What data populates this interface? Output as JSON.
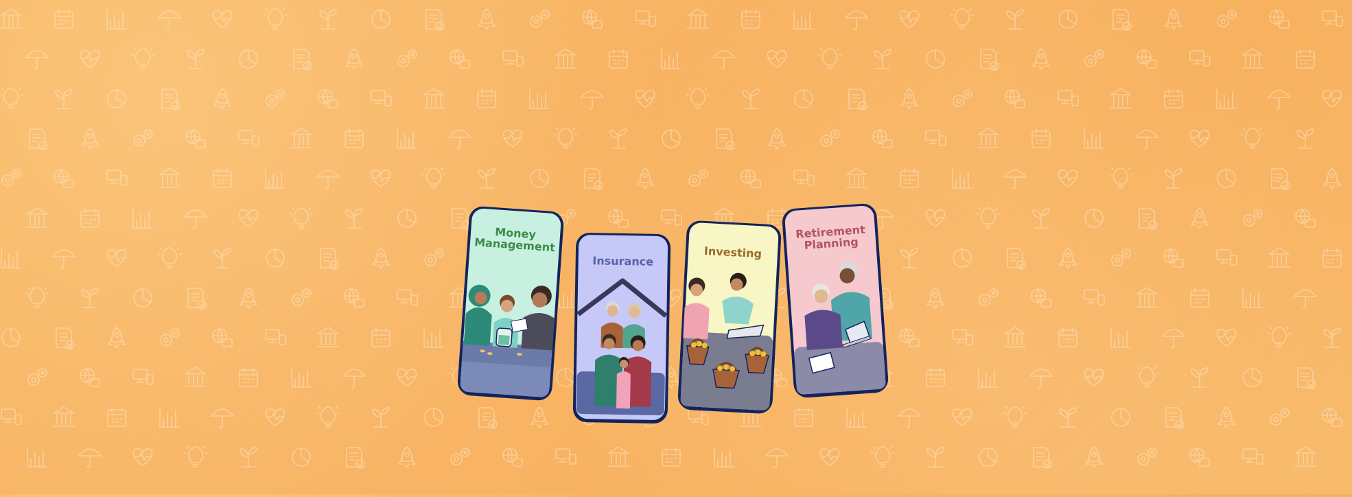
{
  "cards": [
    {
      "label": "Money Management",
      "label_color": "#3a8b49",
      "bg": "#c8f0e0"
    },
    {
      "label": "Insurance",
      "label_color": "#5562a8",
      "bg": "#c6c9f7"
    },
    {
      "label": "Investing",
      "label_color": "#9a6a2a",
      "bg": "#f7f6c4"
    },
    {
      "label": "Retirement Planning",
      "label_color": "#b05560",
      "bg": "#f6c9cf"
    }
  ],
  "background": {
    "base_color": "#f8b565",
    "icon_color": "#fde4c2",
    "icons": [
      "bank-icon",
      "calendar-icon",
      "bar-chart-icon",
      "umbrella-dollar-icon",
      "heart-pulse-icon",
      "lightbulb-icon",
      "plant-icon",
      "pie-chart-icon",
      "document-check-icon",
      "rocket-icon",
      "gears-icon",
      "briefcase-globe-icon",
      "devices-icon"
    ]
  },
  "frame_color": "#13245c"
}
